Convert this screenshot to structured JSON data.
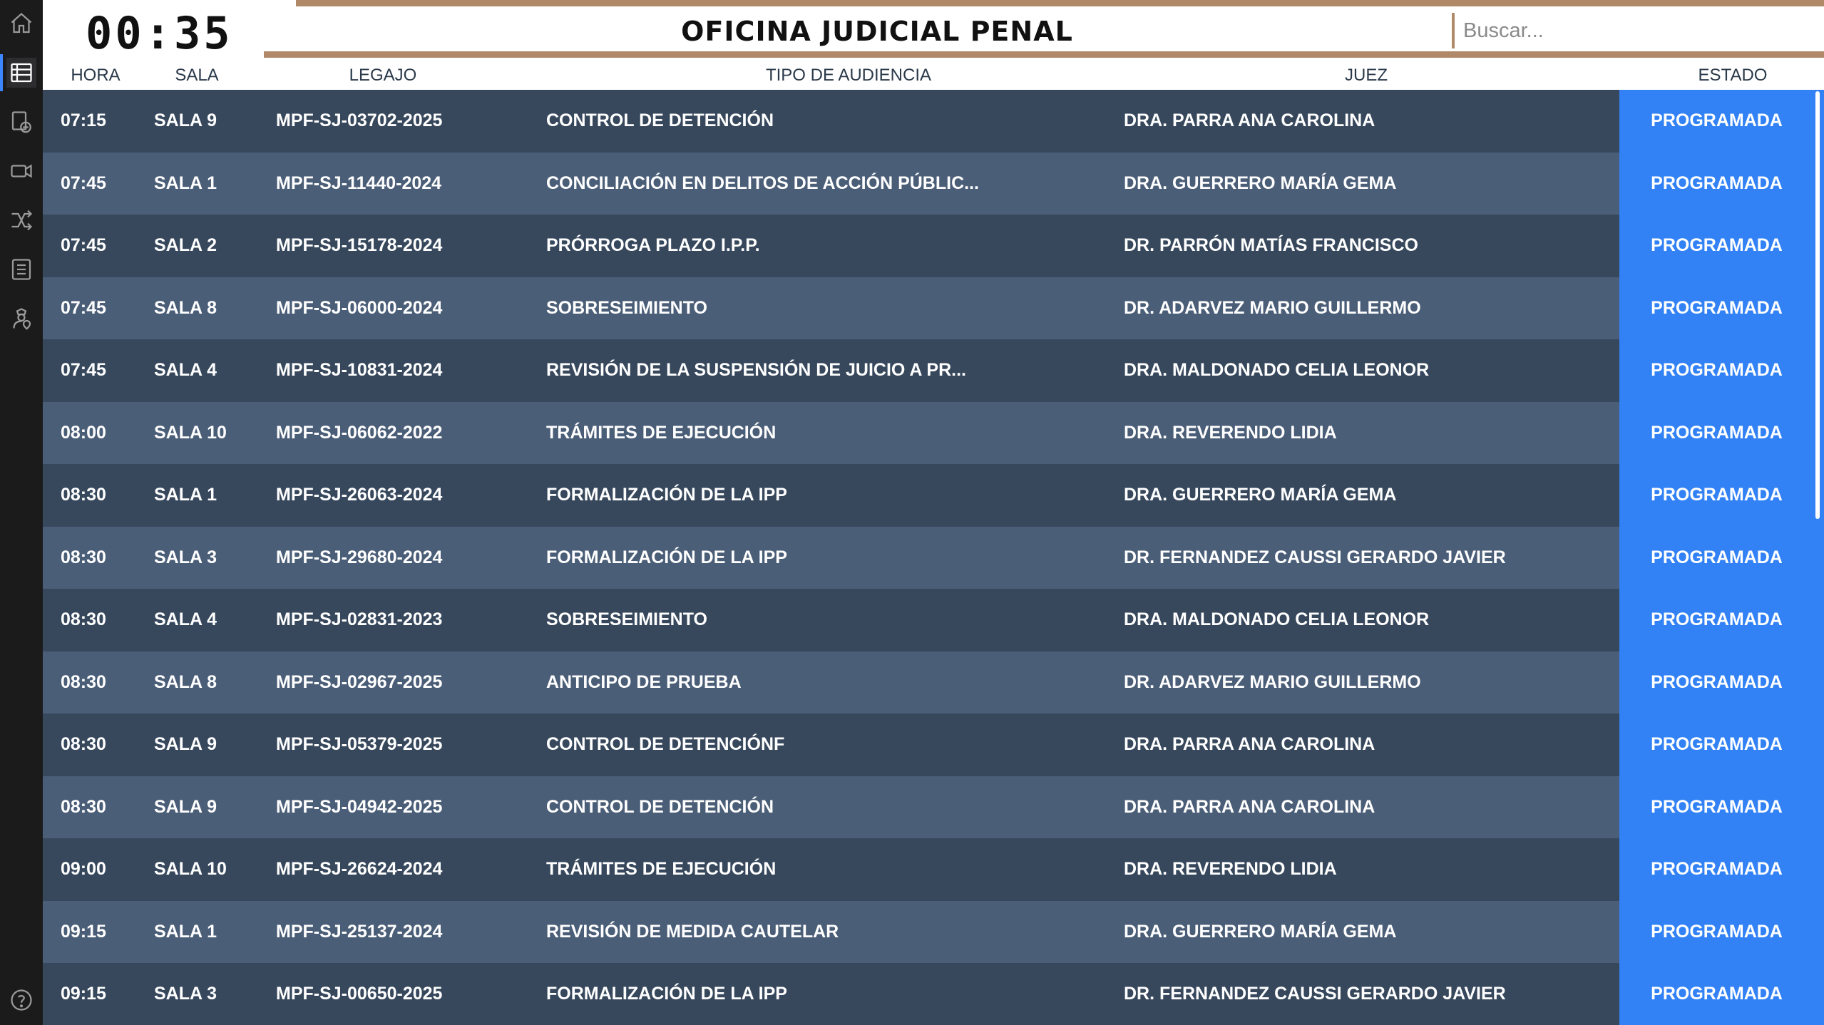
{
  "clock": "00:35",
  "header": {
    "title": "OFICINA JUDICIAL PENAL",
    "search_placeholder": "Buscar..."
  },
  "sidebar": {
    "items": [
      {
        "icon": "home-icon"
      },
      {
        "icon": "table-icon",
        "active": true
      },
      {
        "icon": "add-document-icon"
      },
      {
        "icon": "video-camera-icon"
      },
      {
        "icon": "shuffle-icon"
      },
      {
        "icon": "list-icon"
      },
      {
        "icon": "officer-location-icon"
      }
    ],
    "help_icon": "help-icon"
  },
  "columns": {
    "hora": "HORA",
    "sala": "SALA",
    "legajo": "LEGAJO",
    "tipo": "TIPO DE AUDIENCIA",
    "juez": "JUEZ",
    "estado": "ESTADO"
  },
  "rows": [
    {
      "hora": "07:15",
      "sala": "SALA 9",
      "legajo": "MPF-SJ-03702-2025",
      "tipo": "CONTROL DE DETENCIÓN",
      "juez": "DRA. PARRA ANA CAROLINA",
      "estado": "PROGRAMADA"
    },
    {
      "hora": "07:45",
      "sala": "SALA 1",
      "legajo": "MPF-SJ-11440-2024",
      "tipo": "CONCILIACIÓN EN DELITOS DE ACCIÓN PÚBLIC...",
      "juez": "DRA. GUERRERO MARÍA GEMA",
      "estado": "PROGRAMADA"
    },
    {
      "hora": "07:45",
      "sala": "SALA 2",
      "legajo": "MPF-SJ-15178-2024",
      "tipo": "PRÓRROGA PLAZO I.P.P.",
      "juez": "DR. PARRÓN MATÍAS FRANCISCO",
      "estado": "PROGRAMADA"
    },
    {
      "hora": "07:45",
      "sala": "SALA 8",
      "legajo": "MPF-SJ-06000-2024",
      "tipo": "SOBRESEIMIENTO",
      "juez": "DR. ADARVEZ MARIO GUILLERMO",
      "estado": "PROGRAMADA"
    },
    {
      "hora": "07:45",
      "sala": "SALA 4",
      "legajo": "MPF-SJ-10831-2024",
      "tipo": "REVISIÓN DE LA SUSPENSIÓN DE JUICIO A PR...",
      "juez": "DRA. MALDONADO CELIA LEONOR",
      "estado": "PROGRAMADA"
    },
    {
      "hora": "08:00",
      "sala": "SALA 10",
      "legajo": "MPF-SJ-06062-2022",
      "tipo": "TRÁMITES DE EJECUCIÓN",
      "juez": "DRA. REVERENDO LIDIA",
      "estado": "PROGRAMADA"
    },
    {
      "hora": "08:30",
      "sala": "SALA 1",
      "legajo": "MPF-SJ-26063-2024",
      "tipo": "FORMALIZACIÓN DE LA IPP",
      "juez": "DRA. GUERRERO MARÍA GEMA",
      "estado": "PROGRAMADA"
    },
    {
      "hora": "08:30",
      "sala": "SALA 3",
      "legajo": "MPF-SJ-29680-2024",
      "tipo": "FORMALIZACIÓN DE LA IPP",
      "juez": "DR. FERNANDEZ CAUSSI GERARDO JAVIER",
      "estado": "PROGRAMADA"
    },
    {
      "hora": "08:30",
      "sala": "SALA 4",
      "legajo": "MPF-SJ-02831-2023",
      "tipo": "SOBRESEIMIENTO",
      "juez": "DRA. MALDONADO CELIA LEONOR",
      "estado": "PROGRAMADA"
    },
    {
      "hora": "08:30",
      "sala": "SALA 8",
      "legajo": "MPF-SJ-02967-2025",
      "tipo": "ANTICIPO DE PRUEBA",
      "juez": "DR. ADARVEZ MARIO GUILLERMO",
      "estado": "PROGRAMADA"
    },
    {
      "hora": "08:30",
      "sala": "SALA 9",
      "legajo": "MPF-SJ-05379-2025",
      "tipo": "CONTROL DE DETENCIÓNF",
      "juez": "DRA. PARRA ANA CAROLINA",
      "estado": "PROGRAMADA"
    },
    {
      "hora": "08:30",
      "sala": "SALA 9",
      "legajo": "MPF-SJ-04942-2025",
      "tipo": "CONTROL DE DETENCIÓN",
      "juez": "DRA. PARRA ANA CAROLINA",
      "estado": "PROGRAMADA"
    },
    {
      "hora": "09:00",
      "sala": "SALA 10",
      "legajo": "MPF-SJ-26624-2024",
      "tipo": "TRÁMITES DE EJECUCIÓN",
      "juez": "DRA. REVERENDO LIDIA",
      "estado": "PROGRAMADA"
    },
    {
      "hora": "09:15",
      "sala": "SALA 1",
      "legajo": "MPF-SJ-25137-2024",
      "tipo": "REVISIÓN DE MEDIDA CAUTELAR",
      "juez": "DRA. GUERRERO MARÍA GEMA",
      "estado": "PROGRAMADA"
    },
    {
      "hora": "09:15",
      "sala": "SALA 3",
      "legajo": "MPF-SJ-00650-2025",
      "tipo": "FORMALIZACIÓN DE LA IPP",
      "juez": "DR. FERNANDEZ CAUSSI GERARDO JAVIER",
      "estado": "PROGRAMADA"
    }
  ],
  "colors": {
    "accent_band": "#b08a68",
    "estado_blue": "#3282f6",
    "row_dark": "#37485d",
    "row_light": "#4b5e78",
    "sidebar_bg": "#1b1b1c"
  }
}
